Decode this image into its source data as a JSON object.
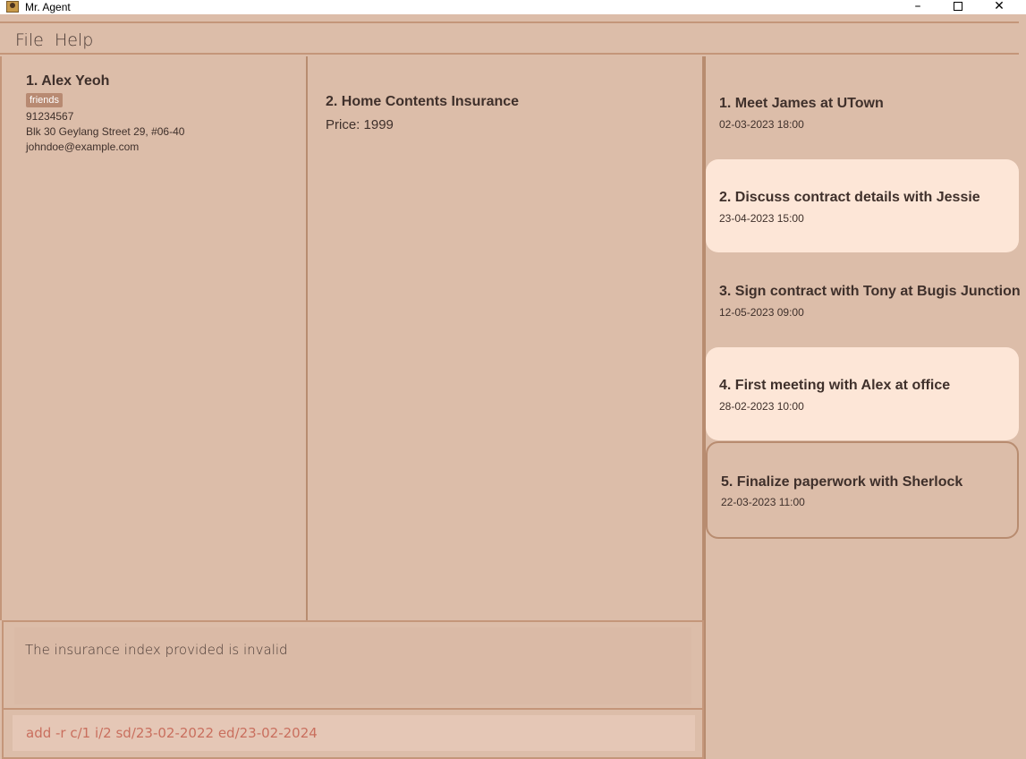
{
  "window": {
    "title": "Mr. Agent",
    "minimize_glyph": "–",
    "close_glyph": "✕"
  },
  "menu": {
    "file": "File",
    "help": "Help"
  },
  "client": {
    "name": "1.  Alex Yeoh",
    "tag": "friends",
    "phone": "91234567",
    "address": "Blk 30 Geylang Street 29, #06-40",
    "email": "johndoe@example.com"
  },
  "insurance": {
    "name": "2.  Home Contents Insurance",
    "price": "Price: 1999"
  },
  "events": [
    {
      "title": "1. Meet James at UTown",
      "date": "02-03-2023 18:00",
      "highlighted": false,
      "selected": false
    },
    {
      "title": "2. Discuss contract details with Jessie",
      "date": "23-04-2023 15:00",
      "highlighted": true,
      "selected": false
    },
    {
      "title": "3. Sign contract with Tony at Bugis Junction",
      "date": "12-05-2023 09:00",
      "highlighted": false,
      "selected": false
    },
    {
      "title": "4. First meeting with Alex at office",
      "date": "28-02-2023 10:00",
      "highlighted": true,
      "selected": false
    },
    {
      "title": "5. Finalize paperwork with Sherlock",
      "date": "22-03-2023 11:00",
      "highlighted": false,
      "selected": true
    }
  ],
  "result": {
    "message": "The insurance index provided is invalid"
  },
  "command": {
    "value": "add -r c/1 i/2 sd/23-02-2022 ed/23-02-2024"
  },
  "colors": {
    "background": "#dcbda9",
    "highlight": "#fde6d7",
    "border": "#c4967a",
    "text": "#3f302b",
    "command_text": "#c96f5e"
  }
}
